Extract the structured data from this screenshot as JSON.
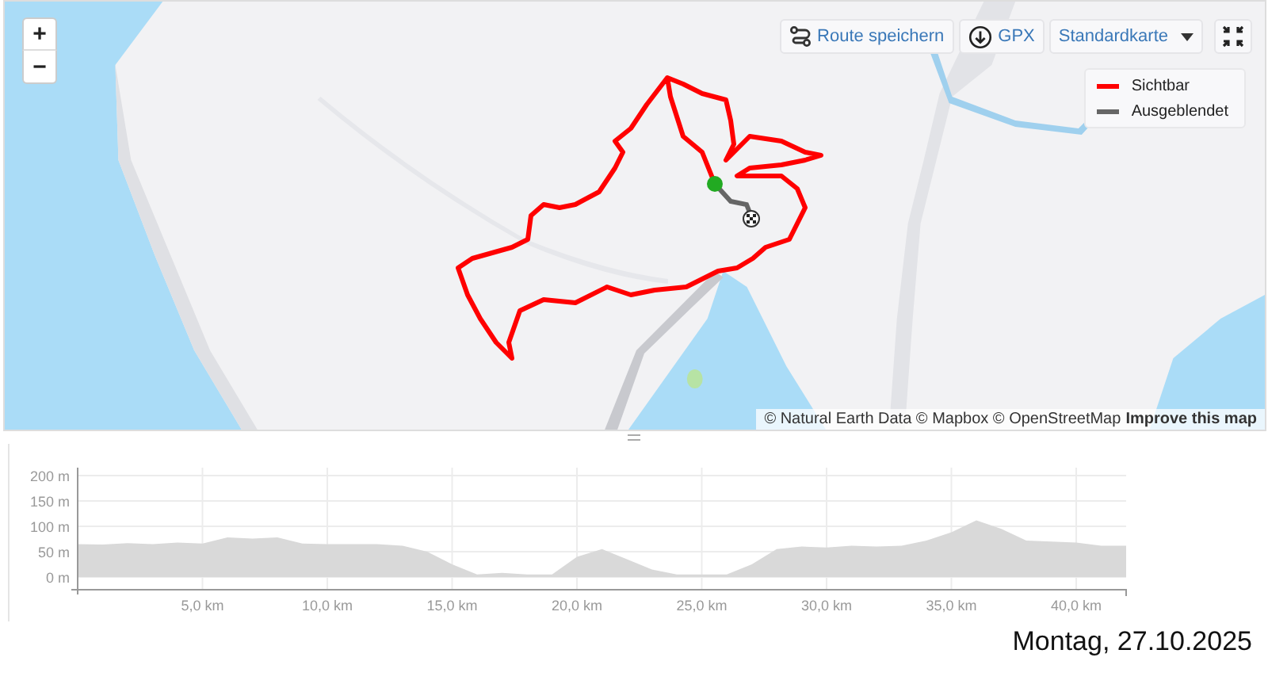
{
  "map": {
    "kind": "picture",
    "zoom_controls": [
      "+",
      "−"
    ],
    "toolbar": [
      {
        "kind": "route",
        "label": "Route speichern"
      },
      {
        "kind": "download",
        "label": "GPX"
      },
      {
        "kind": "dropdown",
        "label": "Standardkarte"
      },
      {
        "kind": "fullscreen"
      }
    ],
    "legend": [
      {
        "label": "Sichtbar",
        "color": "#ff0000"
      },
      {
        "label": "Ausgeblendet",
        "color": "#666666"
      }
    ],
    "attribution": "© Natural Earth Data © Mapbox © OpenStreetMap",
    "attribution_link": "Improve this map"
  },
  "elevation": {
    "chart_data": {
      "type": "area",
      "x": [
        0,
        1,
        2,
        3,
        4,
        5,
        6,
        7,
        8,
        9,
        10,
        11,
        12,
        13,
        14,
        15,
        16,
        17,
        18,
        19,
        20,
        21,
        22,
        23,
        24,
        25,
        26,
        27,
        28,
        29,
        30,
        31,
        32,
        33,
        34,
        35,
        36,
        37,
        38,
        39,
        40,
        41,
        42
      ],
      "series": [
        {
          "color": "#d9d9d9",
          "values": [
            65,
            64,
            67,
            65,
            68,
            66,
            78,
            76,
            78,
            66,
            65,
            65,
            65,
            62,
            50,
            25,
            5,
            8,
            5,
            5,
            40,
            55,
            35,
            15,
            5,
            5,
            5,
            25,
            55,
            60,
            58,
            62,
            60,
            62,
            72,
            88,
            112,
            95,
            72,
            70,
            68,
            62,
            62
          ]
        }
      ],
      "xlim": [
        0,
        42
      ],
      "ylim": [
        -25,
        210
      ],
      "grid": true,
      "xticks": [
        {
          "value": 5,
          "label": "5,0 km"
        },
        {
          "value": 10,
          "label": "10,0 km"
        },
        {
          "value": 15,
          "label": "15,0 km"
        },
        {
          "value": 20,
          "label": "20,0 km"
        },
        {
          "value": 25,
          "label": "25,0 km"
        },
        {
          "value": 30,
          "label": "30,0 km"
        },
        {
          "value": 35,
          "label": "35,0 km"
        },
        {
          "value": 40,
          "label": "40,0 km"
        }
      ],
      "yticks": [
        {
          "value": 0,
          "label": "0 m"
        },
        {
          "value": 50,
          "label": "50 m"
        },
        {
          "value": 100,
          "label": "100 m"
        },
        {
          "value": 150,
          "label": "150 m"
        },
        {
          "value": 200,
          "label": "200 m"
        }
      ]
    }
  },
  "date": "Montag, 27.10.2025"
}
